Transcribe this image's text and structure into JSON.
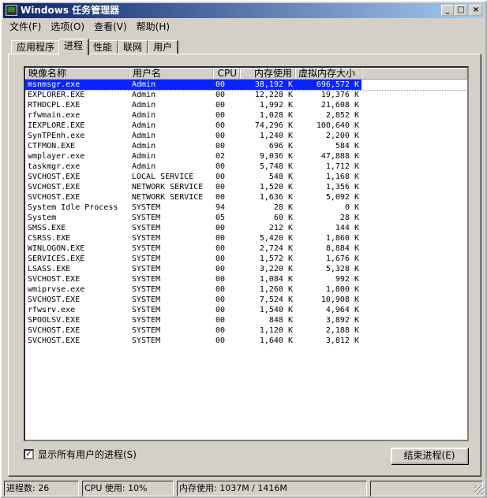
{
  "title": "Windows 任务管理器",
  "menu": [
    "文件(F)",
    "选项(O)",
    "查看(V)",
    "帮助(H)"
  ],
  "tabs": [
    "应用程序",
    "进程",
    "性能",
    "联网",
    "用户"
  ],
  "active_tab": "进程",
  "columns": [
    "映像名称",
    "用户名",
    "CPU",
    "内存使用",
    "虚拟内存大小"
  ],
  "selected_row": 0,
  "processes": [
    [
      "msnmsgr.exe",
      "Admin",
      "00",
      "38,192 K",
      "696,572 K"
    ],
    [
      "EXPLORER.EXE",
      "Admin",
      "00",
      "12,228 K",
      "19,376 K"
    ],
    [
      "RTHDCPL.EXE",
      "Admin",
      "00",
      "1,992 K",
      "21,608 K"
    ],
    [
      "rfwmain.exe",
      "Admin",
      "00",
      "1,028 K",
      "2,852 K"
    ],
    [
      "IEXPLORE.EXE",
      "Admin",
      "00",
      "74,296 K",
      "100,640 K"
    ],
    [
      "SynTPEnh.exe",
      "Admin",
      "00",
      "1,240 K",
      "2,200 K"
    ],
    [
      "CTFMON.EXE",
      "Admin",
      "00",
      "696 K",
      "584 K"
    ],
    [
      "wmplayer.exe",
      "Admin",
      "02",
      "9,036 K",
      "47,888 K"
    ],
    [
      "taskmgr.exe",
      "Admin",
      "00",
      "5,748 K",
      "1,712 K"
    ],
    [
      "SVCHOST.EXE",
      "LOCAL SERVICE",
      "00",
      "548 K",
      "1,168 K"
    ],
    [
      "SVCHOST.EXE",
      "NETWORK SERVICE",
      "00",
      "1,520 K",
      "1,356 K"
    ],
    [
      "SVCHOST.EXE",
      "NETWORK SERVICE",
      "00",
      "1,636 K",
      "5,092 K"
    ],
    [
      "System Idle Process",
      "SYSTEM",
      "94",
      "28 K",
      "0 K"
    ],
    [
      "System",
      "SYSTEM",
      "05",
      "60 K",
      "28 K"
    ],
    [
      "SMSS.EXE",
      "SYSTEM",
      "00",
      "212 K",
      "144 K"
    ],
    [
      "CSRSS.EXE",
      "SYSTEM",
      "00",
      "5,420 K",
      "1,860 K"
    ],
    [
      "WINLOGON.EXE",
      "SYSTEM",
      "00",
      "2,724 K",
      "8,884 K"
    ],
    [
      "SERVICES.EXE",
      "SYSTEM",
      "00",
      "1,572 K",
      "1,676 K"
    ],
    [
      "LSASS.EXE",
      "SYSTEM",
      "00",
      "3,220 K",
      "5,328 K"
    ],
    [
      "SVCHOST.EXE",
      "SYSTEM",
      "00",
      "1,084 K",
      "992 K"
    ],
    [
      "wmiprvse.exe",
      "SYSTEM",
      "00",
      "1,260 K",
      "1,800 K"
    ],
    [
      "SVCHOST.EXE",
      "SYSTEM",
      "00",
      "7,524 K",
      "10,908 K"
    ],
    [
      "rfwsrv.exe",
      "SYSTEM",
      "00",
      "1,540 K",
      "4,964 K"
    ],
    [
      "SPOOLSV.EXE",
      "SYSTEM",
      "00",
      "848 K",
      "3,892 K"
    ],
    [
      "SVCHOST.EXE",
      "SYSTEM",
      "00",
      "1,120 K",
      "2,188 K"
    ],
    [
      "SVCHOST.EXE",
      "SYSTEM",
      "00",
      "1,640 K",
      "3,812 K"
    ]
  ],
  "show_all_users": {
    "label": "显示所有用户的进程(S)",
    "checked": true
  },
  "end_process_label": "结束进程(E)",
  "status": {
    "processes": "进程数: 26",
    "cpu": "CPU 使用: 10%",
    "memory": "内存使用: 1037M / 1416M"
  },
  "colors": {
    "titlebar": "#0a246a",
    "selection": "#0a24ff",
    "face": "#d4d0c8"
  }
}
